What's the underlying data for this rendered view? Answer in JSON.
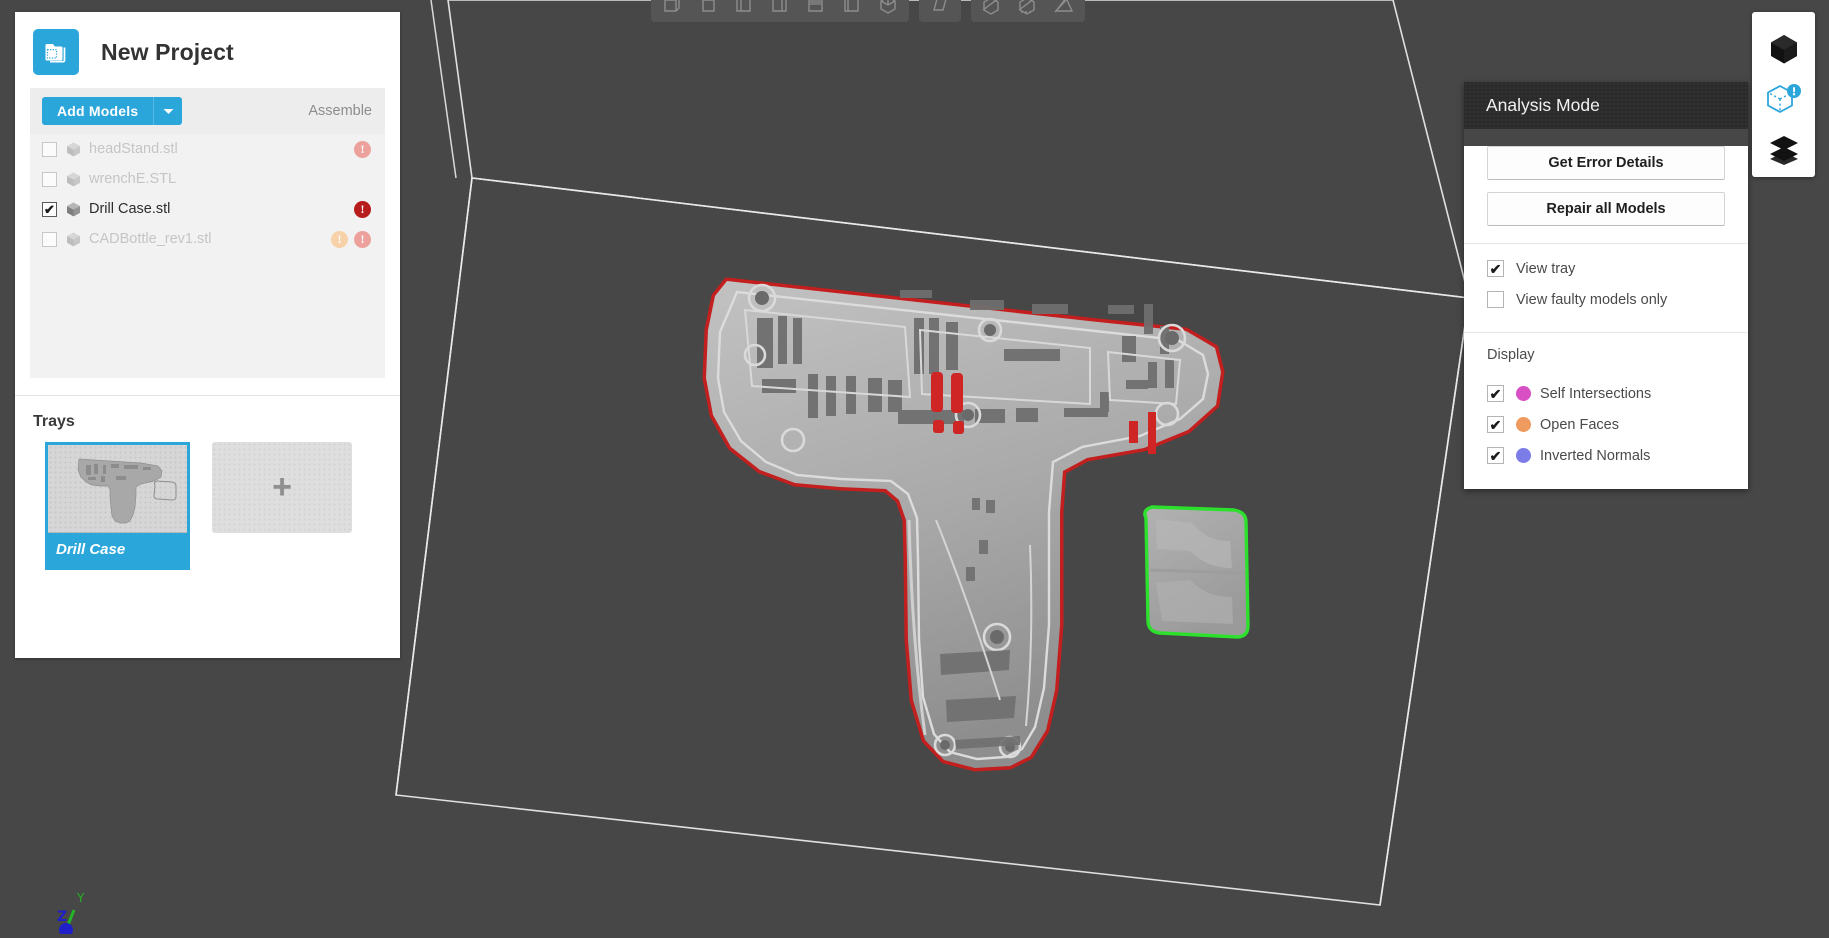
{
  "app": {
    "viewport_bg": "#474747",
    "accent": "#2ba6db"
  },
  "project": {
    "folder_icon": "folder-icon",
    "title": "New Project",
    "toolbar": {
      "add_models_label": "Add Models",
      "add_models_caret_icon": "chevron-down-icon",
      "assemble_label": "Assemble"
    },
    "models": [
      {
        "name": "headStand.stl",
        "checked": false,
        "enabled": false,
        "icon": "mesh-cube-icon",
        "badges": [
          "error-faded"
        ]
      },
      {
        "name": "wrenchE.STL",
        "checked": false,
        "enabled": false,
        "icon": "mesh-cube-icon",
        "badges": []
      },
      {
        "name": "Drill Case.stl",
        "checked": true,
        "enabled": true,
        "icon": "mesh-cube-icon",
        "badges": [
          "error"
        ]
      },
      {
        "name": "CADBottle_rev1.stl",
        "checked": false,
        "enabled": false,
        "icon": "mesh-cube-icon",
        "badges": [
          "warning-faded",
          "error-faded"
        ]
      }
    ],
    "trays": {
      "label": "Trays",
      "selected_tray_name": "Drill Case",
      "add_tray_icon": "plus-icon"
    }
  },
  "analysis": {
    "title": "Analysis Mode",
    "buttons": {
      "error_details": "Get Error Details",
      "repair": "Repair all Models"
    },
    "view_options": [
      {
        "label": "View tray",
        "checked": true
      },
      {
        "label": "View faulty models only",
        "checked": false
      }
    ],
    "display": {
      "label": "Display",
      "items": [
        {
          "label": "Self Intersections",
          "checked": true,
          "color": "#d94fc4"
        },
        {
          "label": "Open Faces",
          "checked": true,
          "color": "#ef9a5e"
        },
        {
          "label": "Inverted Normals",
          "checked": true,
          "color": "#7b7ce8"
        }
      ]
    }
  },
  "right_bar": {
    "items": [
      {
        "icon": "solid-cube-icon",
        "name": "view-solid",
        "active": false
      },
      {
        "icon": "analysis-cube-error-icon",
        "name": "view-analysis",
        "active": true
      },
      {
        "icon": "layers-icon",
        "name": "view-layers",
        "active": false
      }
    ]
  },
  "top_toolbar": {
    "groups": [
      {
        "buttons": [
          "view-front-icon",
          "view-back-icon",
          "view-left-icon",
          "view-right-icon",
          "view-top-icon",
          "view-bottom-icon",
          "view-iso-icon"
        ]
      },
      {
        "buttons": [
          "view-perspective-icon"
        ]
      },
      {
        "buttons": [
          "cut-cube-icon",
          "section-cube-icon",
          "slice-plane-icon"
        ]
      }
    ]
  },
  "viewport": {
    "tray_outline_color": "#e8e8e8",
    "models": [
      {
        "name": "Drill Case.stl",
        "outline": "#c31f1f",
        "status": "faulty"
      },
      {
        "name": "Drill Case clip",
        "outline": "#2ee02e",
        "status": "ok"
      }
    ],
    "axis_gizmo": {
      "y_label": "Y",
      "z_label": "Z",
      "y_color": "#24b324",
      "z_color": "#1f20c9"
    }
  }
}
